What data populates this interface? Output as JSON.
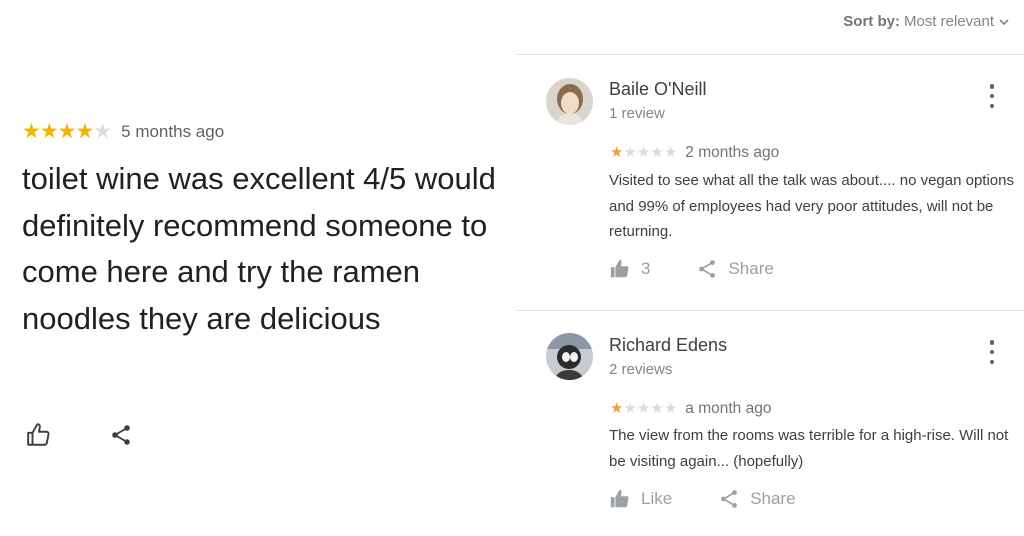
{
  "featured_review": {
    "rating": 4,
    "max_rating": 5,
    "time": "5 months ago",
    "text": "toilet wine was excellent 4/5 would definitely recommend someone to come here and try the ramen noodles they are delicious",
    "like_icon": "thumb-up-outline-icon",
    "share_icon": "share-icon"
  },
  "sort": {
    "label": "Sort by:",
    "value": "Most relevant"
  },
  "reviews": [
    {
      "name": "Baile O'Neill",
      "review_count": "1 review",
      "rating": 1,
      "max_rating": 5,
      "time": "2 months ago",
      "text": "Visited to see what all the talk was about.... no vegan options and 99% of employees had very poor attitudes, will not be returning.",
      "like_label": "3",
      "share_label": "Share"
    },
    {
      "name": "Richard Edens",
      "review_count": "2 reviews",
      "rating": 1,
      "max_rating": 5,
      "time": "a month ago",
      "text": "The view from the rooms was terrible for a high-rise. Will not be visiting again... (hopefully)",
      "like_label": "Like",
      "share_label": "Share"
    }
  ],
  "colors": {
    "star_filled": "#f4b400",
    "star_small_filled": "#e8a33d",
    "star_empty": "#dadce0",
    "divider": "#e0e0e0"
  }
}
